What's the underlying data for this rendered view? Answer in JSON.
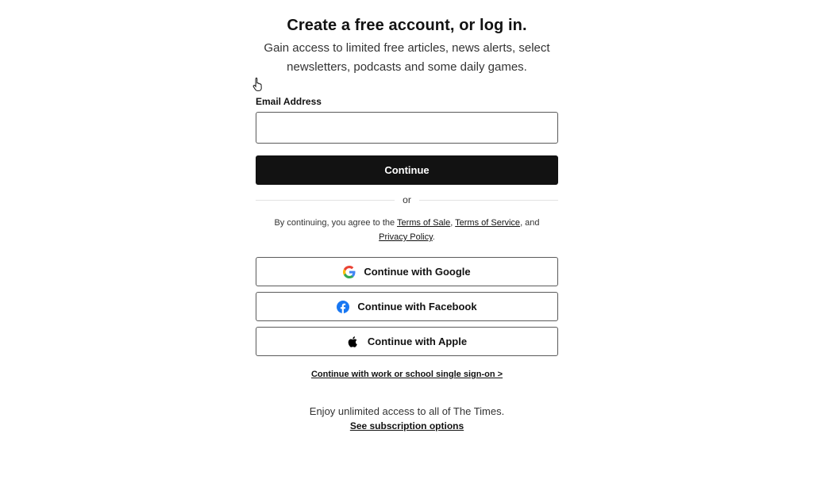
{
  "heading": "Create a free account, or log in.",
  "subtitle": "Gain access to limited free articles, news alerts, select newsletters, podcasts and some daily games.",
  "email": {
    "label": "Email Address",
    "value": "",
    "placeholder": ""
  },
  "continue_label": "Continue",
  "divider_text": "or",
  "legal": {
    "prefix": "By continuing, you agree to the ",
    "terms_of_sale": "Terms of Sale",
    "sep1": ", ",
    "terms_of_service": "Terms of Service",
    "sep2": ", and",
    "privacy_policy": "Privacy Policy",
    "suffix": "."
  },
  "social": {
    "google": "Continue with Google",
    "facebook": "Continue with Facebook",
    "apple": "Continue with Apple"
  },
  "sso_link": "Continue with work or school single sign-on >",
  "footer": {
    "enjoy_text": "Enjoy unlimited access to all of The Times.",
    "subscription_link": "See subscription options"
  },
  "colors": {
    "primary": "#121212",
    "border": "#5a5a5a",
    "divider": "#e2e2e2",
    "facebook_blue": "#1877F2"
  },
  "icons": [
    "google-icon",
    "facebook-icon",
    "apple-icon",
    "hand-cursor-icon"
  ]
}
